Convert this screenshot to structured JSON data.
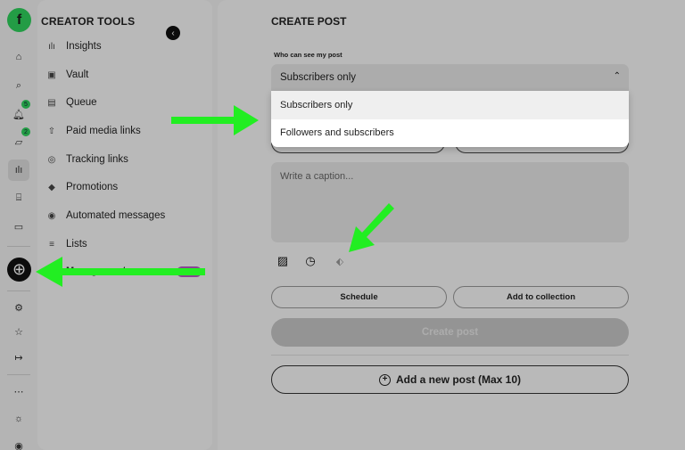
{
  "rail": {
    "logo_glyph": "f",
    "badges": {
      "notifications": "5",
      "messages": "2"
    }
  },
  "sidebar": {
    "title": "CREATOR TOOLS",
    "collapse_glyph": "‹",
    "items": [
      {
        "label": "Insights",
        "icon": "bar-chart-icon",
        "glyph": "ılı"
      },
      {
        "label": "Vault",
        "icon": "vault-icon",
        "glyph": "▣"
      },
      {
        "label": "Queue",
        "icon": "calendar-icon",
        "glyph": "▤"
      },
      {
        "label": "Paid media links",
        "icon": "share-icon",
        "glyph": "⇧"
      },
      {
        "label": "Tracking links",
        "icon": "tracking-icon",
        "glyph": "◎"
      },
      {
        "label": "Promotions",
        "icon": "tag-icon",
        "glyph": "◆"
      },
      {
        "label": "Automated messages",
        "icon": "auto-message-icon",
        "glyph": "◉"
      },
      {
        "label": "Lists",
        "icon": "list-icon",
        "glyph": "≡"
      }
    ],
    "peek_label": "Management"
  },
  "main": {
    "title": "CREATE POST",
    "audience_label": "Who can see my post",
    "audience_selected": "Subscribers only",
    "audience_options": [
      "Subscribers only",
      "Followers and subscribers"
    ],
    "caption_placeholder": "Write a caption...",
    "schedule_label": "Schedule",
    "add_collection_label": "Add to collection",
    "create_label": "Create post",
    "add_post_label": "Add a new post (Max 10)",
    "add_post_glyph": "+"
  },
  "colors": {
    "accent": "#2fd05d",
    "arrow": "#22ee22"
  }
}
